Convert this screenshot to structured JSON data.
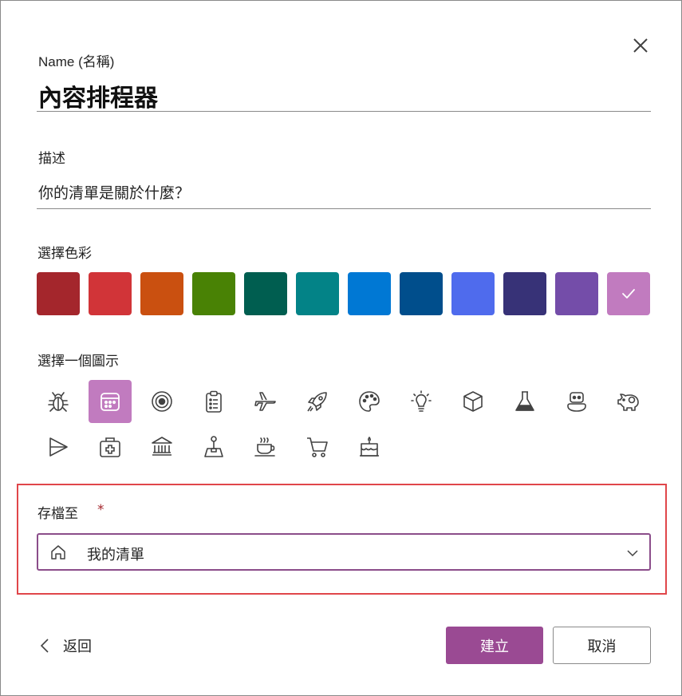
{
  "form": {
    "name_label": "Name (名稱)",
    "name_value": "內容排程器",
    "description_label": "描述",
    "description_placeholder": "你的清單是關於什麼？",
    "color_label": "選擇色彩",
    "icon_label": "選擇一個圖示",
    "save_label": "存檔至",
    "required_mark": "*",
    "save_location": "我的清單"
  },
  "colors": {
    "swatches": [
      "#a4262c",
      "#d13438",
      "#ca5010",
      "#498205",
      "#005e50",
      "#038387",
      "#0078d4",
      "#004e8c",
      "#4f6bed",
      "#373277",
      "#744da9",
      "#c17bbf"
    ],
    "selected_index": 11,
    "accent": "#9a4a93",
    "highlight_border": "#e0464a"
  },
  "icons": {
    "names": [
      "bug-icon",
      "calendar-icon",
      "target-icon",
      "clipboard-list-icon",
      "airplane-icon",
      "rocket-icon",
      "palette-icon",
      "lightbulb-icon",
      "cube-icon",
      "flask-icon",
      "robot-icon",
      "piggy-bank-icon",
      "send-icon",
      "first-aid-kit-icon",
      "bank-icon",
      "joystick-icon",
      "coffee-cup-icon",
      "shopping-cart-icon",
      "cake-icon"
    ],
    "selected": "calendar-icon"
  },
  "footer": {
    "back_label": "返回",
    "create_label": "建立",
    "cancel_label": "取消"
  }
}
